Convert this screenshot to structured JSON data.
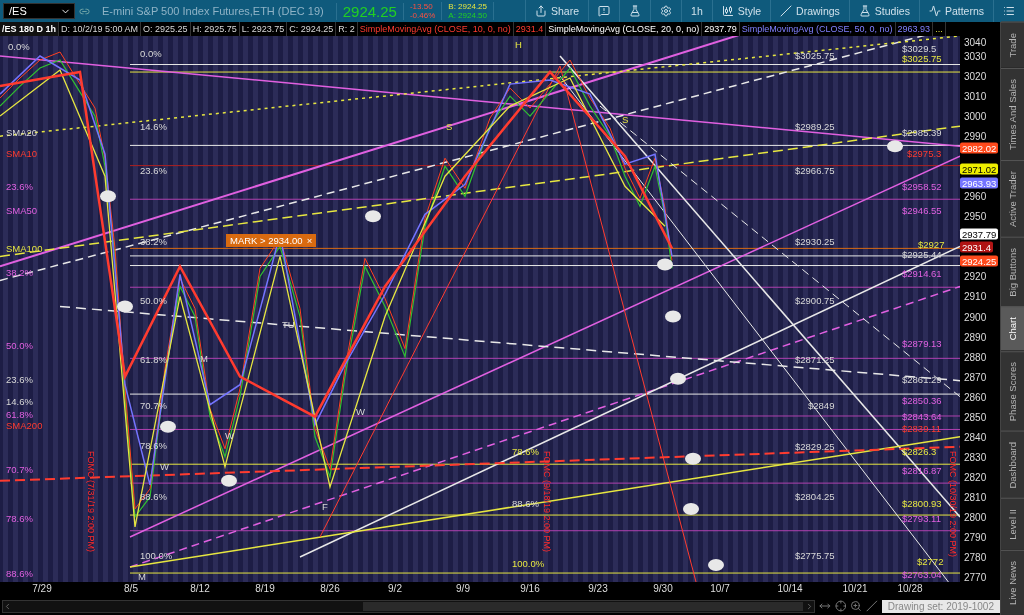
{
  "symbol_field": {
    "value": "/ES"
  },
  "instrument": "E-mini S&P 500 Index Futures,ETH (DEC 19)",
  "last_price": "2924.25",
  "change": "-13.50",
  "change_percent": "-0.46%",
  "bid": "B: 2924.25",
  "ask": "A: 2924.50",
  "toolbar": [
    {
      "kind": "share",
      "label": "Share"
    },
    {
      "kind": "alert"
    },
    {
      "kind": "flask"
    },
    {
      "kind": "gear"
    },
    {
      "kind": "interval",
      "label": "1h"
    },
    {
      "kind": "style",
      "label": "Style"
    },
    {
      "kind": "drawings",
      "label": "Drawings"
    },
    {
      "kind": "studies",
      "label": "Studies"
    },
    {
      "kind": "patterns",
      "label": "Patterns"
    },
    {
      "kind": "menu"
    }
  ],
  "info_bar": [
    {
      "text": "/ES 180 D 1h",
      "kind": "title"
    },
    {
      "text": "D: 10/2/19 5:00 AM",
      "kind": "plain"
    },
    {
      "text": "O: 2925.25",
      "kind": "plain"
    },
    {
      "text": "H: 2925.75",
      "kind": "plain"
    },
    {
      "text": "L: 2923.75",
      "kind": "plain"
    },
    {
      "text": "C: 2924.25",
      "kind": "plain"
    },
    {
      "text": "R: 2",
      "kind": "plain"
    },
    {
      "text": "SimpleMovingAvg (CLOSE, 10, 0, no)",
      "kind": "red"
    },
    {
      "text": "2931.4",
      "kind": "red"
    },
    {
      "text": "SimpleMovingAvg (CLOSE, 20, 0, no)",
      "kind": "white"
    },
    {
      "text": "2937.79",
      "kind": "white"
    },
    {
      "text": "SimpleMovingAvg (CLOSE, 50, 0, no)",
      "kind": "blue"
    },
    {
      "text": "2963.93",
      "kind": "blue"
    },
    {
      "text": "...",
      "kind": "gold"
    }
  ],
  "chart": {
    "mark_label": "MARK > 2934.00",
    "mark_close": "×",
    "labels": [
      {
        "text": "0.0%",
        "kind": "plain"
      },
      {
        "text": "0.0%",
        "kind": "plain"
      },
      {
        "text": "14.6%",
        "kind": "plain"
      },
      {
        "text": "SMA20",
        "kind": "plain"
      },
      {
        "text": "SMA10",
        "kind": "red"
      },
      {
        "text": "23.6%",
        "kind": "plain"
      },
      {
        "text": "23.6%",
        "kind": "pink"
      },
      {
        "text": "SMA50",
        "kind": "pink"
      },
      {
        "text": "38.2%",
        "kind": "plain"
      },
      {
        "text": "SMA100",
        "kind": "gold"
      },
      {
        "text": "38.2%",
        "kind": "pink"
      },
      {
        "text": "50.0%",
        "kind": "plain"
      },
      {
        "text": "50.0%",
        "kind": "pink"
      },
      {
        "text": "61.8%",
        "kind": "plain"
      },
      {
        "text": "23.6%",
        "kind": "plain"
      },
      {
        "text": "14.6%",
        "kind": "plain"
      },
      {
        "text": "70.7%",
        "kind": "plain"
      },
      {
        "text": "61.8%",
        "kind": "pink"
      },
      {
        "text": "SMA200",
        "kind": "red"
      },
      {
        "text": "78.6%",
        "kind": "plain"
      },
      {
        "text": "70.7%",
        "kind": "pink"
      },
      {
        "text": "88.6%",
        "kind": "plain"
      },
      {
        "text": "78.6%",
        "kind": "pink"
      },
      {
        "text": "100.0%",
        "kind": "plain"
      },
      {
        "text": "88.6%",
        "kind": "pink"
      },
      {
        "text": "H",
        "kind": "gold"
      },
      {
        "text": "S",
        "kind": "gold"
      },
      {
        "text": "S",
        "kind": "gold"
      },
      {
        "text": "M",
        "kind": "plain"
      },
      {
        "text": "TU",
        "kind": "plain"
      },
      {
        "text": "W",
        "kind": "plain"
      },
      {
        "text": "W",
        "kind": "plain"
      },
      {
        "text": "W",
        "kind": "plain"
      },
      {
        "text": "F",
        "kind": "plain"
      },
      {
        "text": "M",
        "kind": "plain"
      },
      {
        "text": "78.6%",
        "kind": "gold"
      },
      {
        "text": "88.6%",
        "kind": "plain"
      },
      {
        "text": "100.0%",
        "kind": "gold"
      },
      {
        "text": "$3029.5",
        "kind": "plain"
      },
      {
        "text": "$3025.75",
        "kind": "plain"
      },
      {
        "text": "$3025.75",
        "kind": "gold"
      },
      {
        "text": "$2989.25",
        "kind": "plain"
      },
      {
        "text": "$2985.39",
        "kind": "plain"
      },
      {
        "text": "$2975.3",
        "kind": "red"
      },
      {
        "text": "$2966.75",
        "kind": "plain"
      },
      {
        "text": "$2958.52",
        "kind": "pink"
      },
      {
        "text": "$2946.55",
        "kind": "pink"
      },
      {
        "text": "$2930.25",
        "kind": "plain"
      },
      {
        "text": "$2927",
        "kind": "gold"
      },
      {
        "text": "$2925.44",
        "kind": "plain"
      },
      {
        "text": "$2914.61",
        "kind": "pink"
      },
      {
        "text": "$2900.75",
        "kind": "plain"
      },
      {
        "text": "$2879.13",
        "kind": "pink"
      },
      {
        "text": "$2871.25",
        "kind": "plain"
      },
      {
        "text": "$2861.29",
        "kind": "plain"
      },
      {
        "text": "$2850.36",
        "kind": "pink"
      },
      {
        "text": "$2849",
        "kind": "plain"
      },
      {
        "text": "$2843.64",
        "kind": "pink"
      },
      {
        "text": "$2839.11",
        "kind": "red"
      },
      {
        "text": "$2829.25",
        "kind": "plain"
      },
      {
        "text": "$2826.3",
        "kind": "gold"
      },
      {
        "text": "$2816.87",
        "kind": "pink"
      },
      {
        "text": "$2804.25",
        "kind": "plain"
      },
      {
        "text": "$2800.93",
        "kind": "gold"
      },
      {
        "text": "$2793.11",
        "kind": "pink"
      },
      {
        "text": "$2775.75",
        "kind": "plain"
      },
      {
        "text": "$2772",
        "kind": "gold"
      },
      {
        "text": "$2763.04",
        "kind": "pink"
      }
    ],
    "event_labels": [
      "FOMC (7/31/19 2:00 PM)",
      "FOMC (9/18/19 2:00 PM)",
      "FOMC (10/30/19 2:00 PM)"
    ],
    "price_tags": [
      {
        "text": "2982.02",
        "color": "#ff4a1c"
      },
      {
        "text": "2971.02",
        "color": "#eeee00"
      },
      {
        "text": "2963.93",
        "color": "#7474ff"
      },
      {
        "text": "2937.79",
        "color": "#ffffff"
      },
      {
        "text": "2931.4",
        "color": "#b01414"
      },
      {
        "text": "2924.25",
        "color": "#ff4a1c"
      }
    ]
  },
  "price_axis": [
    "3040",
    "3030",
    "3020",
    "3010",
    "3000",
    "2990",
    "2960",
    "2950",
    "2920",
    "2910",
    "2900",
    "2890",
    "2880",
    "2870",
    "2860",
    "2850",
    "2840",
    "2830",
    "2820",
    "2810",
    "2800",
    "2790",
    "2780",
    "2770"
  ],
  "date_axis": [
    "7/29",
    "8/5",
    "8/12",
    "8/19",
    "8/26",
    "9/2",
    "9/9",
    "9/16",
    "9/23",
    "9/30",
    "10/7",
    "10/14",
    "10/21",
    "10/28"
  ],
  "drawing_set": "Drawing set: 2019-1002",
  "side_tabs": [
    {
      "label": "Trade",
      "selected": false
    },
    {
      "label": "Times And Sales",
      "selected": false
    },
    {
      "label": "Active Trader",
      "selected": false
    },
    {
      "label": "Big Buttons",
      "selected": false
    },
    {
      "label": "Chart",
      "selected": true
    },
    {
      "label": "Phase Scores",
      "selected": false
    },
    {
      "label": "Dashboard",
      "selected": false
    },
    {
      "label": "Level II",
      "selected": false
    },
    {
      "label": "Live News",
      "selected": false
    }
  ]
}
